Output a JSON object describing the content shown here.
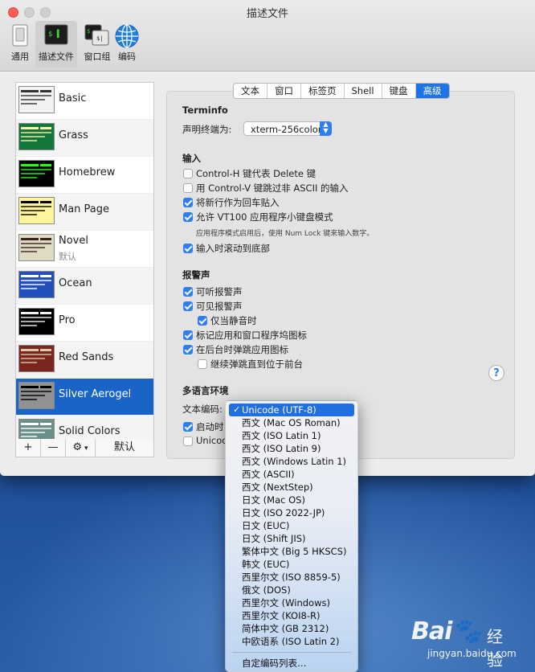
{
  "window": {
    "title": "描述文件"
  },
  "toolbar": {
    "items": [
      {
        "label": "通用",
        "icon": "switch-icon"
      },
      {
        "label": "描述文件",
        "icon": "terminal-icon"
      },
      {
        "label": "窗口组",
        "icon": "window-group-icon"
      },
      {
        "label": "编码",
        "icon": "globe-icon"
      }
    ]
  },
  "profiles": [
    {
      "name": "Basic",
      "bg": "#f2f2f2",
      "fg": "#333333"
    },
    {
      "name": "Grass",
      "bg": "#13773d",
      "fg": "#fff0a5"
    },
    {
      "name": "Homebrew",
      "bg": "#000000",
      "fg": "#28fe14"
    },
    {
      "name": "Man Page",
      "bg": "#fef49c",
      "fg": "#000000"
    },
    {
      "name": "Novel",
      "sub": "默认",
      "bg": "#dfdbc3",
      "fg": "#3b2322"
    },
    {
      "name": "Ocean",
      "bg": "#224fbc",
      "fg": "#ffffff"
    },
    {
      "name": "Pro",
      "bg": "#000000",
      "fg": "#f2f2f2"
    },
    {
      "name": "Red Sands",
      "bg": "#7a251e",
      "fg": "#d7c9a7"
    },
    {
      "name": "Silver Aerogel",
      "bg": "#929292",
      "fg": "#000000"
    },
    {
      "name": "Solid Colors",
      "bg": "#6a8f8a",
      "fg": "#ffffff"
    }
  ],
  "list_controls": {
    "add": "+",
    "remove": "—",
    "gear": "⚙",
    "default": "默认"
  },
  "tabs": [
    "文本",
    "窗口",
    "标签页",
    "Shell",
    "键盘",
    "高级"
  ],
  "active_tab": "高级",
  "terminfo": {
    "heading": "Terminfo",
    "declare_label": "声明终端为:",
    "declare_value": "xterm-256color"
  },
  "input": {
    "heading": "输入",
    "opt1": "Control-H 键代表 Delete 键",
    "opt2": "用 Control-V 键跳过非 ASCII 的输入",
    "opt3": "将新行作为回车贴入",
    "opt4": "允许 VT100 应用程序小键盘模式",
    "opt4_note": "应用程序模式启用后，使用 Num Lock 键来输入数字。",
    "opt5": "输入时滚动到底部"
  },
  "bell": {
    "heading": "报警声",
    "opt1": "可听报警声",
    "opt2": "可见报警声",
    "opt3": "仅当静音时",
    "opt4": "标记应用和窗口程序坞图标",
    "opt5": "在后台时弹跳应用图标",
    "opt6": "继续弹跳直到位于前台"
  },
  "intl": {
    "heading": "多语言环境",
    "encoding_label": "文本编码:",
    "row2_partial": "启动时",
    "row3_partial": "Unicod"
  },
  "encoding_menu": {
    "selected": "Unicode (UTF-8)",
    "items": [
      "Unicode (UTF-8)",
      "西文 (Mac OS Roman)",
      "西文 (ISO Latin 1)",
      "西文 (ISO Latin 9)",
      "西文 (Windows Latin 1)",
      "西文 (ASCII)",
      "西文 (NextStep)",
      "日文 (Mac OS)",
      "日文 (ISO 2022-JP)",
      "日文 (EUC)",
      "日文 (Shift JIS)",
      "繁体中文 (Big 5 HKSCS)",
      "韩文 (EUC)",
      "西里尔文 (ISO 8859-5)",
      "俄文 (DOS)",
      "西里尔文 (Windows)",
      "西里尔文 (KOI8-R)",
      "简体中文 (GB 2312)",
      "中欧语系 (ISO Latin 2)"
    ],
    "customize": "自定编码列表…"
  },
  "help": "?",
  "watermark": {
    "logo": "Bai🐾经验",
    "url": "jingyan.baidu.com"
  },
  "colors": {
    "accent": "#1e73e6",
    "selection": "#1a64c8"
  }
}
